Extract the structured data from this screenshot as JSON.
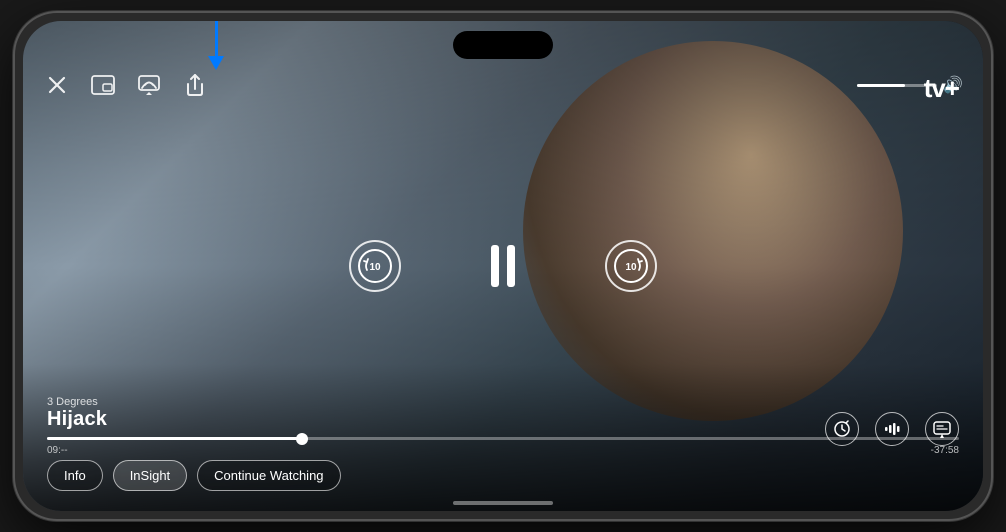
{
  "app": {
    "name": "Apple TV+",
    "logo": "tv+"
  },
  "phone": {
    "dynamic_island": true
  },
  "arrow": {
    "color": "#007AFF",
    "label": "AirPlay indicator arrow"
  },
  "top_controls": {
    "close_label": "✕",
    "picture_in_picture_label": "⧉",
    "airplay_label": "airplay",
    "share_label": "share",
    "volume_icon": "🔊",
    "volume_level": 60
  },
  "appletv": {
    "apple_symbol": "",
    "tv_text": "tv+",
    "volume_label": "volume"
  },
  "video": {
    "episode": "3 Degrees",
    "title": "Hijack",
    "current_time": "09:--",
    "remaining_time": "-37:58",
    "progress_pct": 28
  },
  "playback": {
    "rewind_label": "10",
    "forward_label": "10",
    "pause_label": "pause"
  },
  "right_controls": {
    "speed_label": "speed",
    "audio_label": "audio",
    "subtitles_label": "subtitles"
  },
  "pills": [
    {
      "id": "info",
      "label": "Info"
    },
    {
      "id": "insight",
      "label": "InSight"
    },
    {
      "id": "continue-watching",
      "label": "Continue Watching"
    }
  ],
  "home_indicator": true
}
